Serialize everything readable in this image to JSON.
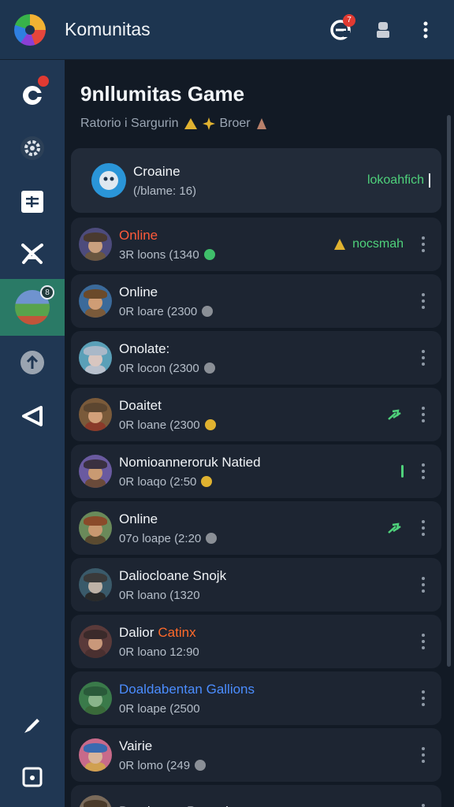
{
  "topbar": {
    "title": "Komunitas",
    "notif_count": "7"
  },
  "sidebar": {
    "game_badge": "8"
  },
  "main": {
    "title": "9nllumitas Game",
    "subtitle_prefix": "Ratorio i Sargurin",
    "subtitle_suffix": "Broer"
  },
  "header_card": {
    "name": "Croaine",
    "sub": "(/blame: 16)",
    "action": "lokoahfich"
  },
  "members": [
    {
      "name": "Online",
      "status": "3R  loons (1340",
      "right": "nocsmah",
      "name_color": "#ff5a3a",
      "avatar": [
        "#4d4b7c",
        "#caa07e",
        "#4a3a30",
        "#6a5640"
      ],
      "sicon": "#3fbf6a"
    },
    {
      "name": "Online",
      "status": "0R  loare (2300",
      "right": "",
      "name_color": "#f1f4f7",
      "avatar": [
        "#3b6a9a",
        "#cf9d75",
        "#6b4a2a",
        "#7a5a3a"
      ],
      "sicon": "#8a8f96"
    },
    {
      "name": "Onolate:",
      "status": "0R  locon (2300",
      "right": "",
      "name_color": "#f1f4f7",
      "avatar": [
        "#5aa0b8",
        "#d8c6c0",
        "#a9b8c8",
        "#b8c0cc"
      ],
      "sicon": "#8a8f96"
    },
    {
      "name": "Doaitet",
      "status": "0R  loane (2300",
      "right": "arrow",
      "name_color": "#f1f4f7",
      "avatar": [
        "#7a5a3a",
        "#d2a07a",
        "#5c4630",
        "#8a3a2a"
      ],
      "sicon": "#e0b230"
    },
    {
      "name": "Nomioanneroruk Natied",
      "status": "0R  loaqo (2:50",
      "right": "bar",
      "name_color": "#f1f4f7",
      "avatar": [
        "#6a5aa0",
        "#c99a72",
        "#3a3040",
        "#6a4a3a"
      ],
      "sicon": "#e0b230"
    },
    {
      "name": "Online",
      "status": "07o  loape (2:20",
      "right": "arrow",
      "name_color": "#f1f4f7",
      "avatar": [
        "#6a8a5a",
        "#c89870",
        "#8a4a2a",
        "#5a4a30"
      ],
      "sicon": "#8a8f96"
    },
    {
      "name": "Daliocloane Snojk",
      "status": "0R  loano (1320",
      "right": "",
      "name_color": "#f1f4f7",
      "avatar": [
        "#3a5a6a",
        "#bfb2a6",
        "#3a3a3a",
        "#2a2a2a"
      ],
      "sicon": ""
    },
    {
      "name": "Dalior",
      "name_extra": "Catinx",
      "status": "0R  loano 12:90",
      "right": "",
      "name_color": "#f1f4f7",
      "avatar": [
        "#5a3a3a",
        "#c9987a",
        "#3a2a2a",
        "#4a3030"
      ],
      "sicon": ""
    },
    {
      "name": "Doaldabentan Gallions",
      "status": "0R  loape (2500",
      "right": "",
      "name_color": "#f1f4f7",
      "name_first_color": "#4b8dff",
      "avatar": [
        "#3a7a4a",
        "#8ab48a",
        "#2a5a3a",
        "#3a6a3a"
      ],
      "sicon": ""
    },
    {
      "name": "Vairie",
      "status": "0R  lomo (249",
      "right": "",
      "name_color": "#f1f4f7",
      "avatar": [
        "#c86a8a",
        "#d8b49a",
        "#3a6ab0",
        "#d0a050"
      ],
      "sicon": "#8a8f96"
    },
    {
      "name": "Demiootas Panopks",
      "status": "",
      "right": "",
      "name_color": "#f1f4f7",
      "avatar": [
        "#7a6a5a",
        "#c89a78",
        "#4a3a2a",
        "#5a4a3a"
      ],
      "sicon": ""
    }
  ]
}
